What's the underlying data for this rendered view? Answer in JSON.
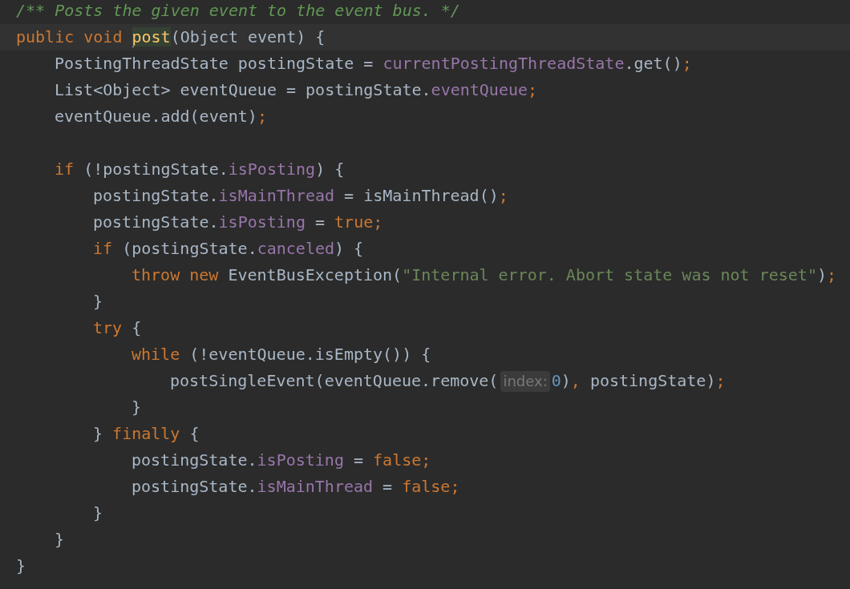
{
  "editor": {
    "lines": [
      {
        "tokens": [
          {
            "kind": "comment",
            "text": "/** Posts the given event to the event bus. */"
          }
        ]
      },
      {
        "tokens": [
          {
            "kind": "keyword",
            "text": "public void "
          },
          {
            "kind": "caret"
          },
          {
            "kind": "highlighted",
            "text": "post"
          },
          {
            "kind": "plain",
            "text": "(Object event) {"
          }
        ],
        "children": [
          {
            "tokens": [
              {
                "kind": "plain",
                "text": "PostingThreadState postingState = "
              },
              {
                "kind": "field",
                "text": "currentPostingThreadState"
              },
              {
                "kind": "plain",
                "text": ".get()"
              },
              {
                "kind": "keyword",
                "text": ";"
              }
            ]
          },
          {
            "tokens": [
              {
                "kind": "plain",
                "text": "List<Object> eventQueue = postingState."
              },
              {
                "kind": "field",
                "text": "eventQueue"
              },
              {
                "kind": "keyword",
                "text": ";"
              }
            ]
          },
          {
            "tokens": [
              {
                "kind": "plain",
                "text": "eventQueue.add(event)"
              },
              {
                "kind": "keyword",
                "text": ";"
              }
            ]
          },
          {
            "kind": "blank"
          },
          {
            "tokens": [
              {
                "kind": "keyword",
                "text": "if "
              },
              {
                "kind": "plain",
                "text": "(!postingState."
              },
              {
                "kind": "field",
                "text": "isPosting"
              },
              {
                "kind": "plain",
                "text": ") {"
              }
            ],
            "children": [
              {
                "tokens": [
                  {
                    "kind": "plain",
                    "text": "postingState."
                  },
                  {
                    "kind": "field",
                    "text": "isMainThread"
                  },
                  {
                    "kind": "plain",
                    "text": " = isMainThread()"
                  },
                  {
                    "kind": "keyword",
                    "text": ";"
                  }
                ]
              },
              {
                "tokens": [
                  {
                    "kind": "plain",
                    "text": "postingState."
                  },
                  {
                    "kind": "field",
                    "text": "isPosting"
                  },
                  {
                    "kind": "plain",
                    "text": " = "
                  },
                  {
                    "kind": "keyword",
                    "text": "true;"
                  }
                ]
              },
              {
                "tokens": [
                  {
                    "kind": "keyword",
                    "text": "if "
                  },
                  {
                    "kind": "plain",
                    "text": "(postingState."
                  },
                  {
                    "kind": "field",
                    "text": "canceled"
                  },
                  {
                    "kind": "plain",
                    "text": ") {"
                  }
                ],
                "children": [
                  {
                    "tokens": [
                      {
                        "kind": "keyword",
                        "text": "throw new "
                      },
                      {
                        "kind": "plain",
                        "text": "EventBusException("
                      },
                      {
                        "kind": "string",
                        "text": "\"Internal error. Abort state was not reset\""
                      },
                      {
                        "kind": "plain",
                        "text": ")"
                      },
                      {
                        "kind": "keyword",
                        "text": ";"
                      }
                    ]
                  }
                ]
              },
              {
                "tokens": [
                  {
                    "kind": "plain",
                    "text": "}"
                  }
                ]
              },
              {
                "tokens": [
                  {
                    "kind": "keyword",
                    "text": "try "
                  },
                  {
                    "kind": "plain",
                    "text": "{"
                  }
                ],
                "children": [
                  {
                    "tokens": [
                      {
                        "kind": "keyword",
                        "text": "while "
                      },
                      {
                        "kind": "plain",
                        "text": "(!eventQueue.isEmpty()) {"
                      }
                    ],
                    "children": [
                      {
                        "tokens": [
                          {
                            "kind": "plain",
                            "text": "postSingleEvent(eventQueue.remove("
                          },
                          {
                            "kind": "hint",
                            "text": "index:"
                          },
                          {
                            "kind": "number",
                            "text": "0"
                          },
                          {
                            "kind": "plain",
                            "text": ")"
                          },
                          {
                            "kind": "keyword",
                            "text": ", "
                          },
                          {
                            "kind": "plain",
                            "text": "postingState)"
                          },
                          {
                            "kind": "keyword",
                            "text": ";"
                          }
                        ]
                      }
                    ]
                  },
                  {
                    "tokens": [
                      {
                        "kind": "plain",
                        "text": "}"
                      }
                    ]
                  }
                ]
              },
              {
                "tokens": [
                  {
                    "kind": "plain",
                    "text": "} "
                  },
                  {
                    "kind": "keyword",
                    "text": "finally "
                  },
                  {
                    "kind": "plain",
                    "text": "{"
                  }
                ],
                "children": [
                  {
                    "tokens": [
                      {
                        "kind": "plain",
                        "text": "postingState."
                      },
                      {
                        "kind": "field",
                        "text": "isPosting"
                      },
                      {
                        "kind": "plain",
                        "text": " = "
                      },
                      {
                        "kind": "keyword",
                        "text": "false;"
                      }
                    ]
                  },
                  {
                    "tokens": [
                      {
                        "kind": "plain",
                        "text": "postingState."
                      },
                      {
                        "kind": "field",
                        "text": "isMainThread"
                      },
                      {
                        "kind": "plain",
                        "text": " = "
                      },
                      {
                        "kind": "keyword",
                        "text": "false;"
                      }
                    ]
                  }
                ]
              },
              {
                "tokens": [
                  {
                    "kind": "plain",
                    "text": "}"
                  }
                ]
              }
            ]
          },
          {
            "tokens": [
              {
                "kind": "plain",
                "text": "}"
              }
            ]
          }
        ]
      },
      {
        "tokens": [
          {
            "kind": "plain",
            "text": "}"
          }
        ]
      }
    ]
  }
}
